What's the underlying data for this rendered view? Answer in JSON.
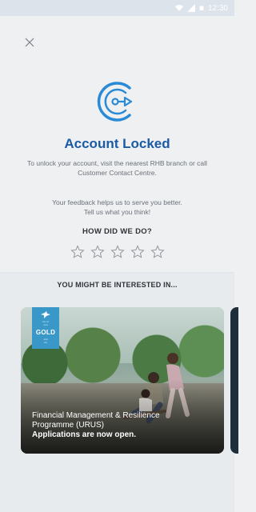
{
  "status_bar": {
    "time": "12:30",
    "icons": [
      "wifi-icon",
      "signal-icon",
      "battery-icon"
    ]
  },
  "header": {
    "close_icon": "close-icon"
  },
  "locked": {
    "icon": "account-locked-icon",
    "title": "Account Locked",
    "subtitle_line1": "To unlock your account, visit the nearest RHB branch or call",
    "subtitle_line2": "Customer Contact Centre."
  },
  "feedback": {
    "line1": "Your feedback helps us to serve you better.",
    "line2": "Tell us what you think!",
    "question": "HOW DID WE DO?",
    "rating": 0,
    "max_rating": 5
  },
  "recommendations": {
    "title": "YOU MIGHT BE INTERESTED IN...",
    "cards": [
      {
        "badge_label": "GOLD",
        "title_line1": "Financial Management & Resilience",
        "title_line2": "Programme (URUS)",
        "cta": "Applications are now open."
      }
    ]
  },
  "colors": {
    "accent": "#1a5aa7",
    "icon_blue": "#2a8ad6",
    "badge": "#3a98c8"
  }
}
